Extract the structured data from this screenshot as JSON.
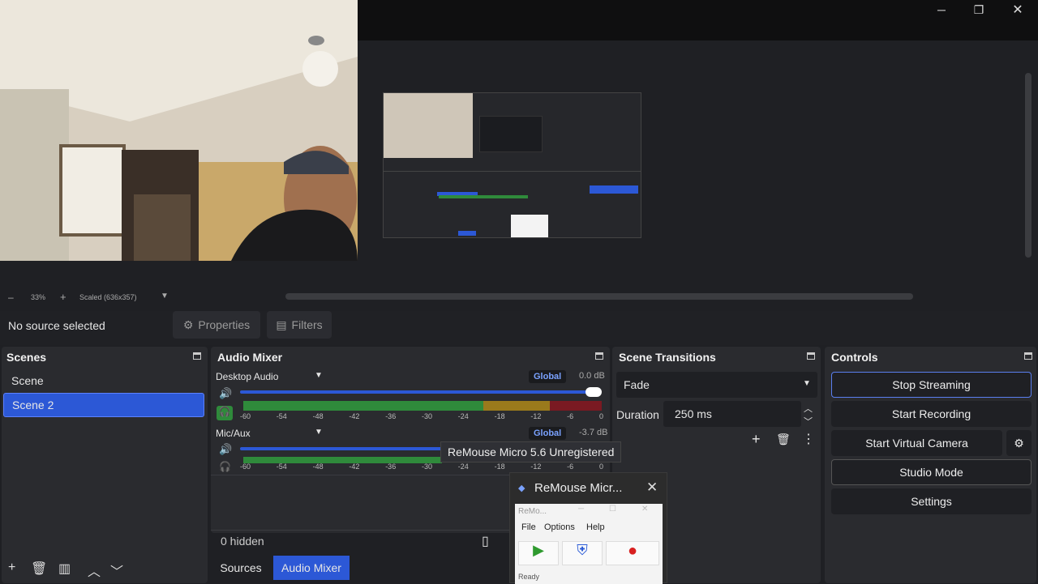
{
  "preview": {
    "zoom_minus": "–",
    "zoom_level": "33%",
    "zoom_plus": "+",
    "scale_mode": "Scaled (636x357)"
  },
  "window_controls": {
    "minimize": "─",
    "maximize": "❐",
    "close": "✕"
  },
  "source_toolbar": {
    "status": "No source selected",
    "properties_label": "Properties",
    "filters_label": "Filters"
  },
  "scenes": {
    "title": "Scenes",
    "items": [
      {
        "label": "Scene",
        "selected": false
      },
      {
        "label": "Scene 2",
        "selected": true
      }
    ]
  },
  "audio_mixer": {
    "title": "Audio Mixer",
    "channels": [
      {
        "name": "Desktop Audio",
        "badge": "Global",
        "db": "0.0 dB",
        "volume": 1.0
      },
      {
        "name": "Mic/Aux",
        "badge": "Global",
        "db": "-3.7 dB",
        "volume": 0.62
      }
    ],
    "ticks": [
      "-60",
      "-54",
      "-48",
      "-42",
      "-36",
      "-30",
      "-24",
      "-18",
      "-12",
      "-6",
      "0"
    ],
    "hidden_label": "0 hidden"
  },
  "bottom_tabs": {
    "sources": "Sources",
    "audio_mixer": "Audio Mixer"
  },
  "scene_transitions": {
    "title": "Scene Transitions",
    "transition": "Fade",
    "duration_label": "Duration",
    "duration_value": "250 ms"
  },
  "controls": {
    "title": "Controls",
    "stop_streaming": "Stop Streaming",
    "start_recording": "Start Recording",
    "start_virtual_camera": "Start Virtual Camera",
    "studio_mode": "Studio Mode",
    "settings": "Settings"
  },
  "tooltip": {
    "text": "ReMouse Micro 5.6 Unregistered"
  },
  "remouse_taskbar": {
    "title": "ReMouse Micr..."
  },
  "remouse_window": {
    "title": "ReMo...",
    "menu": [
      "File",
      "Options",
      "Help"
    ],
    "status": "Ready"
  },
  "colors": {
    "accent": "#2c58d6",
    "panel": "#2a2b2f",
    "background": "#1f2024",
    "meter_green": "#2f8a3b",
    "meter_yellow": "#9a7a1c",
    "meter_red": "#7a1a22"
  }
}
